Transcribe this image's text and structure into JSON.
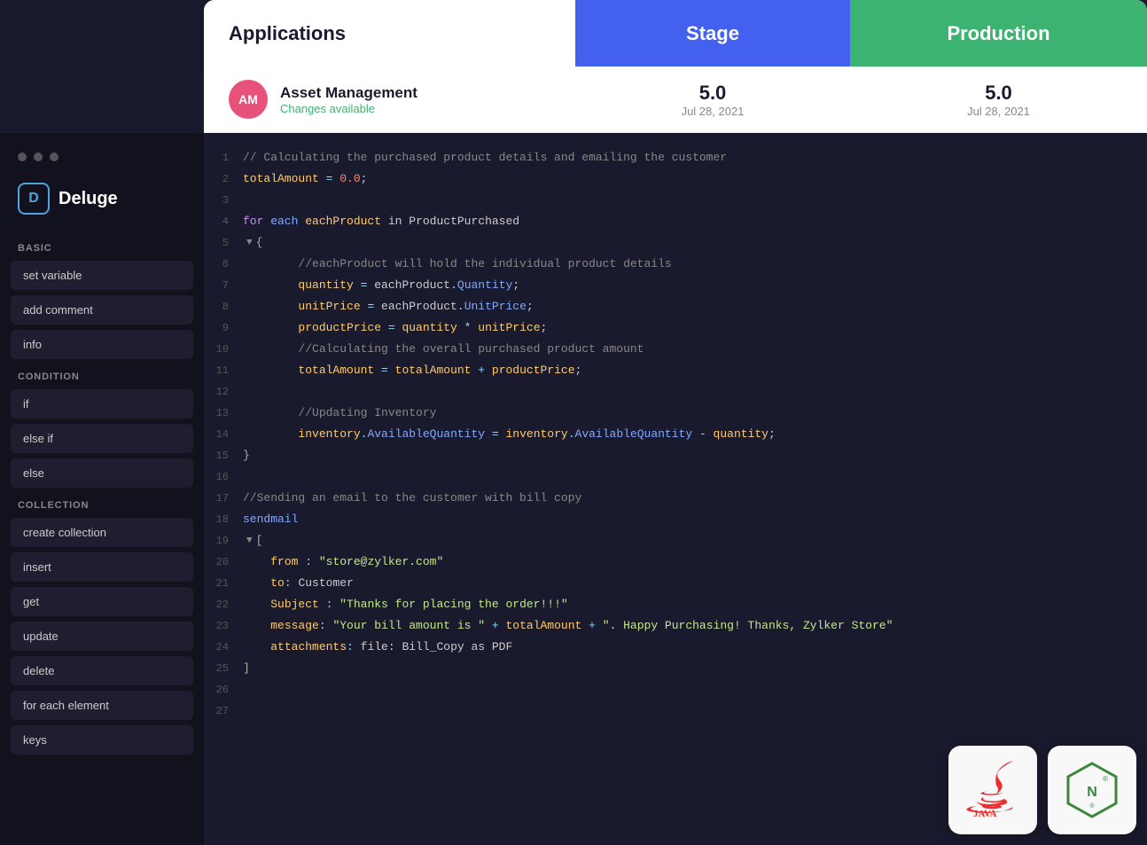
{
  "topbar": {
    "app_label": "Applications",
    "stage_label": "Stage",
    "production_label": "Production"
  },
  "app_row": {
    "avatar": "AM",
    "name": "Asset Management",
    "changes": "Changes available",
    "stage_version": "5.0",
    "stage_date": "Jul 28, 2021",
    "prod_version": "5.0",
    "prod_date": "Jul 28, 2021"
  },
  "sidebar": {
    "dots": [
      "dot1",
      "dot2",
      "dot3"
    ],
    "brand_icon": "D",
    "brand_name": "Deluge",
    "section_basic": "BASIC",
    "btn_set_variable": "set variable",
    "btn_add_comment": "add comment",
    "btn_info": "info",
    "section_condition": "CONDITION",
    "btn_if": "if",
    "btn_else_if": "else if",
    "btn_else": "else",
    "section_collection": "COLLECTION",
    "btn_create_collection": "create collection",
    "btn_insert": "insert",
    "btn_get": "get",
    "btn_update": "update",
    "btn_delete": "delete",
    "btn_for_each": "for each element",
    "btn_keys": "keys"
  },
  "code": {
    "lines": [
      {
        "num": 1,
        "text": "// Calculating the purchased product details and emailing the customer",
        "type": "comment"
      },
      {
        "num": 2,
        "text": "totalAmount = 0.0;",
        "type": "var"
      },
      {
        "num": 3,
        "text": "",
        "type": "empty"
      },
      {
        "num": 4,
        "text": "for each eachProduct in ProductPurchased",
        "type": "foreach"
      },
      {
        "num": 5,
        "text": "{",
        "type": "bracket",
        "collapse": true
      },
      {
        "num": 6,
        "text": "    //eachProduct will hold the individual product details",
        "type": "comment"
      },
      {
        "num": 7,
        "text": "    quantity = eachProduct.Quantity;",
        "type": "code"
      },
      {
        "num": 8,
        "text": "    unitPrice = eachProduct.UnitPrice;",
        "type": "code"
      },
      {
        "num": 9,
        "text": "    productPrice = quantity * unitPrice;",
        "type": "code"
      },
      {
        "num": 10,
        "text": "    //Calculating the overall purchased product amount",
        "type": "comment"
      },
      {
        "num": 11,
        "text": "    totalAmount = totalAmount + productPrice;",
        "type": "code"
      },
      {
        "num": 12,
        "text": "",
        "type": "empty"
      },
      {
        "num": 13,
        "text": "    //Updating Inventory",
        "type": "comment"
      },
      {
        "num": 14,
        "text": "    inventory.AvailableQuantity = inventory.AvailableQuantity - quantity;",
        "type": "code"
      },
      {
        "num": 15,
        "text": "}",
        "type": "bracket"
      },
      {
        "num": 16,
        "text": "",
        "type": "empty"
      },
      {
        "num": 17,
        "text": "//Sending an email to the customer with bill copy",
        "type": "comment"
      },
      {
        "num": 18,
        "text": "sendmail",
        "type": "fn"
      },
      {
        "num": 19,
        "text": "[",
        "type": "bracket",
        "collapse": true
      },
      {
        "num": 20,
        "text": "    from : \"store@zylker.com\"",
        "type": "mail-prop"
      },
      {
        "num": 21,
        "text": "    to: Customer",
        "type": "mail-prop2"
      },
      {
        "num": 22,
        "text": "    Subject : \"Thanks for placing the order!!!\"",
        "type": "mail-prop"
      },
      {
        "num": 23,
        "text": "    message: \"Your bill amount is \" + totalAmount + \". Happy Purchasing! Thanks, Zylker Store\"",
        "type": "mail-msg"
      },
      {
        "num": 24,
        "text": "    attachments: file: Bill_Copy as PDF",
        "type": "mail-att"
      },
      {
        "num": 25,
        "text": "]",
        "type": "bracket"
      },
      {
        "num": 26,
        "text": "",
        "type": "empty"
      },
      {
        "num": 27,
        "text": "",
        "type": "empty"
      }
    ]
  }
}
